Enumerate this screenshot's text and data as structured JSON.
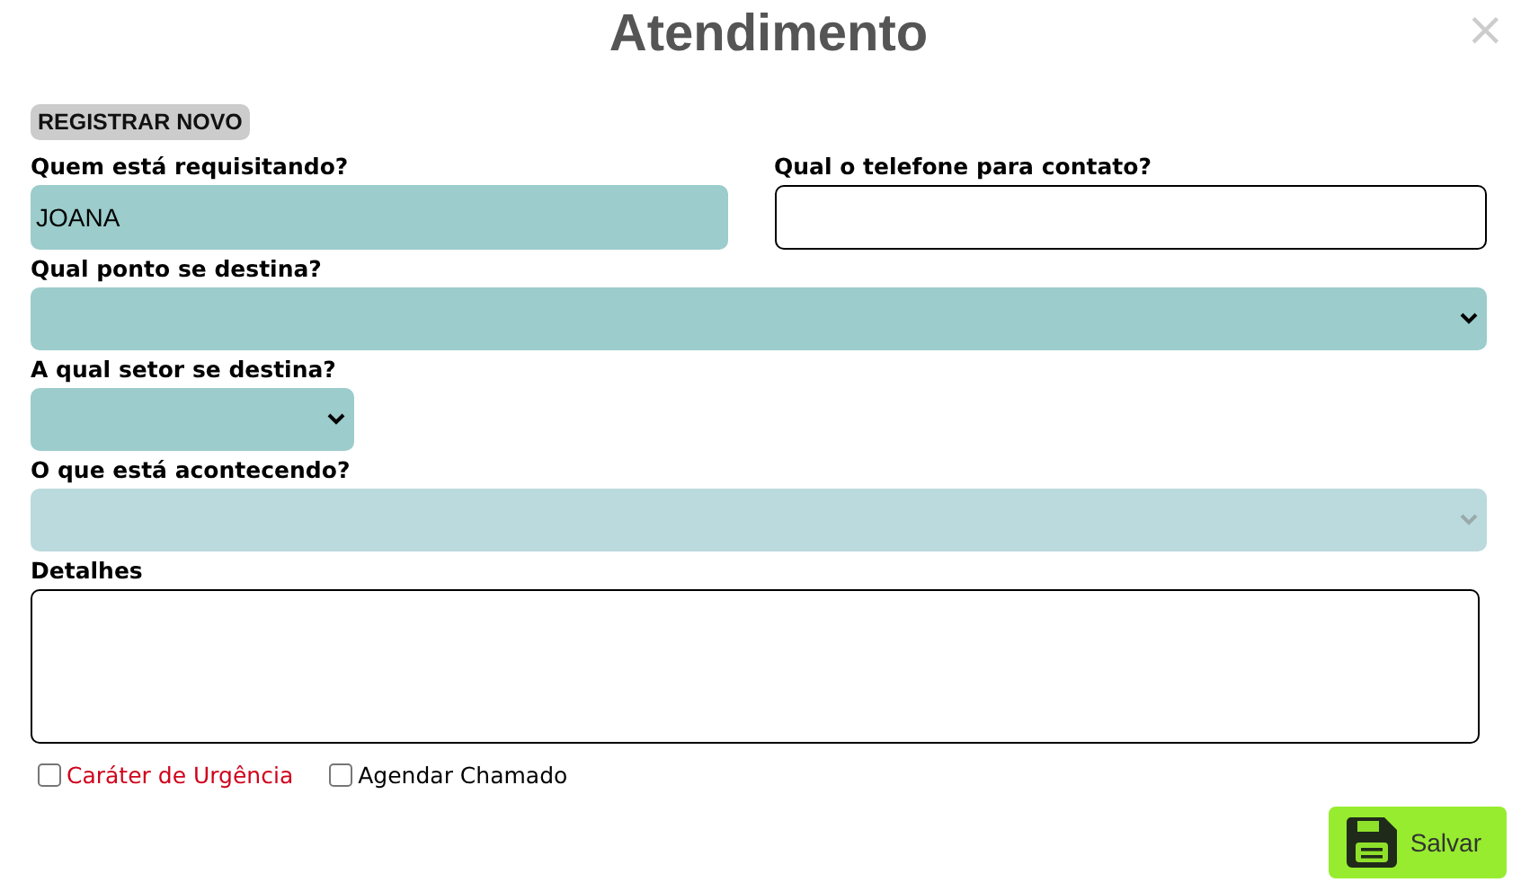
{
  "dialog": {
    "title": "Atendimento",
    "close": "×"
  },
  "register_button": "REGISTRAR NOVO",
  "rows": [
    [
      {
        "label": "Quem está requisitando?",
        "kind": "text",
        "value": "JOANA",
        "filled": true
      },
      {
        "label": "Qual o telefone para contato?",
        "kind": "text",
        "filled": false
      }
    ],
    [
      {
        "label": "Qual ponto se destina?",
        "kind": "select",
        "filled": true,
        "disabled": false
      }
    ],
    [
      {
        "label": "A qual setor se destina?",
        "kind": "select",
        "filled": true,
        "disabled": false
      }
    ],
    [
      {
        "label": "O que está acontecendo?",
        "kind": "select",
        "filled": true,
        "disabled": true
      }
    ],
    [
      {
        "label": "Detalhes",
        "kind": "textarea",
        "filled": false
      }
    ]
  ],
  "checkboxes": [
    {
      "label": "Caráter de Urgência",
      "checked": false,
      "color": "#d0021b"
    },
    {
      "label": "Agendar Chamado",
      "checked": false,
      "color": "#000000"
    }
  ],
  "save_button": "Salvar"
}
